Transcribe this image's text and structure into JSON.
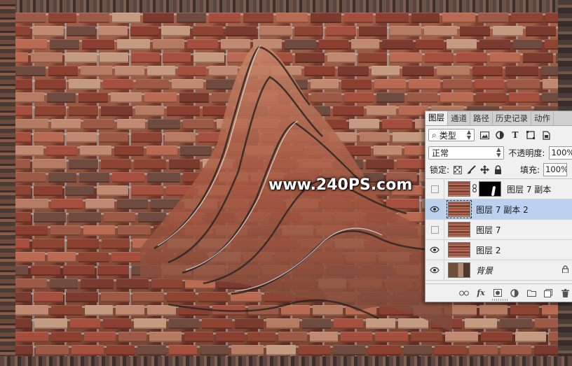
{
  "watermark": "www.240PS.com",
  "panel": {
    "tabs": [
      {
        "label": "图层",
        "active": true
      },
      {
        "label": "通道",
        "active": false
      },
      {
        "label": "路径",
        "active": false
      },
      {
        "label": "历史记录",
        "active": false
      },
      {
        "label": "动作",
        "active": false
      }
    ],
    "filter_label": "类型",
    "blend_mode": "正常",
    "opacity_label": "不透明度:",
    "opacity_value": "100%",
    "lock_label": "锁定:",
    "fill_label": "填充:",
    "fill_value": "100%",
    "layers": [
      {
        "name": "图层 7 副本",
        "visible": false,
        "has_mask": true,
        "selected": false
      },
      {
        "name": "图层 7 副本 2",
        "visible": true,
        "has_mask": false,
        "selected": true
      },
      {
        "name": "图层 7",
        "visible": false,
        "has_mask": false,
        "selected": false
      },
      {
        "name": "图层 2",
        "visible": true,
        "has_mask": false,
        "selected": false
      },
      {
        "name": "背景",
        "visible": true,
        "has_mask": false,
        "selected": false,
        "locked": true
      }
    ]
  },
  "colors": {
    "selected_layer": "#bcd0ef",
    "panel_bg": "#f0f0f0",
    "brick_red": "#a5503e"
  }
}
